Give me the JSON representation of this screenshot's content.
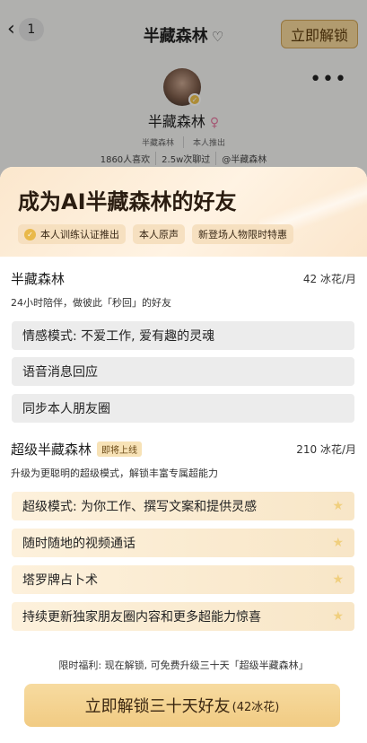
{
  "nav": {
    "back_count": "1",
    "title": "半藏森林",
    "unlock_label": "立即解锁"
  },
  "profile": {
    "name": "半藏森林",
    "tags": [
      "半藏森林",
      "本人推出"
    ],
    "stats": [
      "1860人喜欢",
      "2.5w次聊过",
      "@半藏森林"
    ]
  },
  "sheet": {
    "title": "成为AI半藏森林的好友",
    "chips": [
      "本人训练认证推出",
      "本人原声",
      "新登场人物限时特惠"
    ],
    "plans": [
      {
        "name": "半藏森林",
        "price": "42 冰花/月",
        "desc": "24小时陪伴，做彼此「秒回」的好友",
        "features": [
          "情感模式: 不爱工作, 爱有趣的灵魂",
          "语音消息回应",
          "同步本人朋友圈"
        ]
      },
      {
        "name": "超级半藏森林",
        "badge": "即将上线",
        "price": "210 冰花/月",
        "desc": "升级为更聪明的超级模式，解锁丰富专属超能力",
        "features": [
          "超级模式: 为你工作、撰写文案和提供灵感",
          "随时随地的视频通话",
          "塔罗牌占卜术",
          "持续更新独家朋友圈内容和更多超能力惊喜"
        ]
      }
    ],
    "benefit": "限时福利: 现在解锁, 可免费升级三十天「超级半藏森林」",
    "cta_main": "立即解锁三十天好友",
    "cta_sub": "(42冰花)"
  },
  "icons": {
    "back": "chevron-left-icon",
    "heart": "heart-outline-icon",
    "more": "more-dots-icon",
    "verified": "check-badge-icon",
    "gender": "female-icon",
    "star": "star-icon"
  },
  "colors": {
    "accent_gold": "#f1cb83",
    "chip_bg": "#f5debc",
    "star": "#f0cf7e"
  }
}
